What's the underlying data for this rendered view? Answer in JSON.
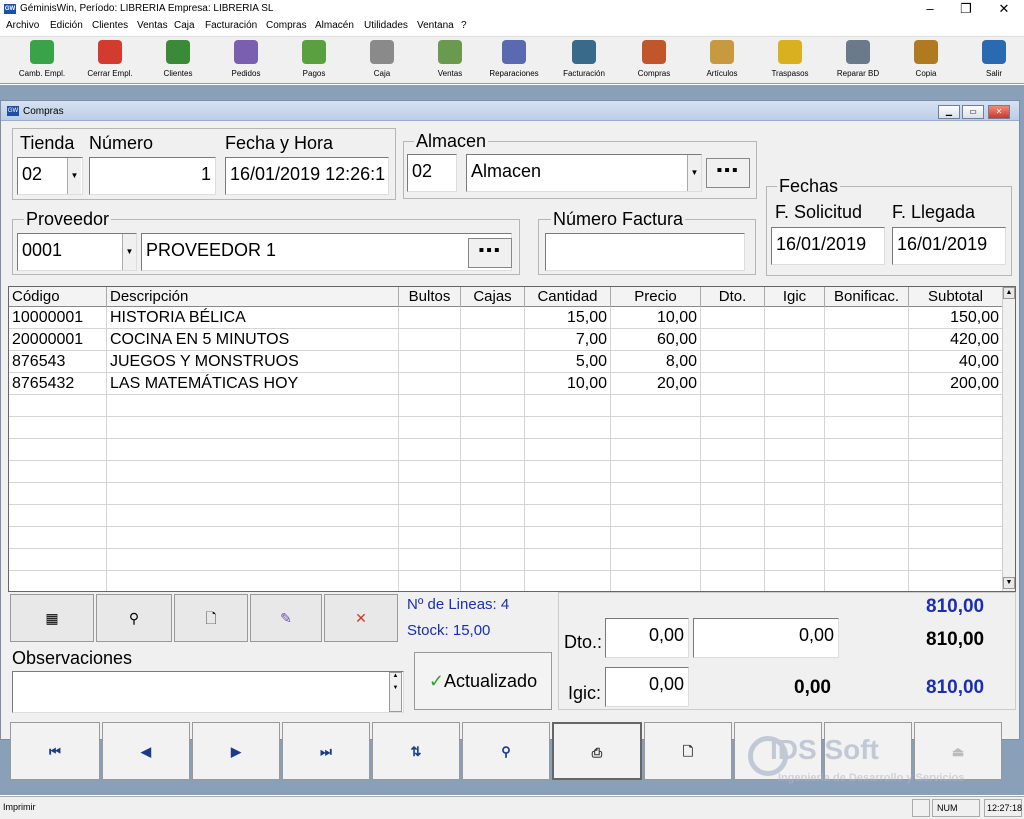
{
  "app": {
    "title": "GéminisWin, Período: LIBRERIA Empresa: LIBRERIA SL",
    "icon": "GW"
  },
  "menu": [
    "Archivo",
    "Edición",
    "Clientes",
    "Ventas",
    "Caja",
    "Facturación",
    "Compras",
    "Almacén",
    "Utilidades",
    "Ventana",
    "?"
  ],
  "toolbar": [
    {
      "label": "Camb. Empl.",
      "icon": "user-add-icon",
      "color": "#3aa34a"
    },
    {
      "label": "Cerrar Empl.",
      "icon": "user-close-icon",
      "color": "#d33b2f"
    },
    {
      "label": "Clientes",
      "icon": "clients-icon",
      "color": "#3a8a3a"
    },
    {
      "label": "Pedidos",
      "icon": "orders-icon",
      "color": "#7a5fb0"
    },
    {
      "label": "Pagos",
      "icon": "payments-icon",
      "color": "#5aa040"
    },
    {
      "label": "Caja",
      "icon": "cash-register-icon",
      "color": "#8a8a8a"
    },
    {
      "label": "Ventas",
      "icon": "sales-icon",
      "color": "#6a9a50"
    },
    {
      "label": "Reparaciones",
      "icon": "repair-icon",
      "color": "#5a6ab0"
    },
    {
      "label": "Facturación",
      "icon": "invoice-icon",
      "color": "#3a6a8a"
    },
    {
      "label": "Compras",
      "icon": "cart-icon",
      "color": "#c0562a"
    },
    {
      "label": "Artículos",
      "icon": "boxes-icon",
      "color": "#c89a40"
    },
    {
      "label": "Traspasos",
      "icon": "transfer-icon",
      "color": "#d8b020"
    },
    {
      "label": "Reparar BD",
      "icon": "database-icon",
      "color": "#6a7a8a"
    },
    {
      "label": "Copia",
      "icon": "copy-icon",
      "color": "#b07a20"
    },
    {
      "label": "Salir",
      "icon": "exit-icon",
      "color": "#2a6ab0"
    }
  ],
  "window": {
    "title": "Compras"
  },
  "form": {
    "tienda_label": "Tienda",
    "tienda_value": "02",
    "numero_label": "Número",
    "numero_value": "1",
    "fecha_label": "Fecha y Hora",
    "fecha_value": "16/01/2019 12:26:1",
    "almacen_label": "Almacen",
    "almacen_code": "02",
    "almacen_name": "Almacen",
    "proveedor_label": "Proveedor",
    "proveedor_code": "0001",
    "proveedor_name": "PROVEEDOR 1",
    "factura_label": "Número Factura",
    "factura_value": "",
    "fechas_label": "Fechas",
    "solicitud_label": "F. Solicitud",
    "solicitud_value": "16/01/2019",
    "llegada_label": "F. Llegada",
    "llegada_value": "16/01/2019"
  },
  "grid": {
    "headers": [
      "Código",
      "Descripción",
      "Bultos",
      "Cajas",
      "Cantidad",
      "Precio",
      "Dto.",
      "Igic",
      "Bonificac.",
      "Subtotal"
    ],
    "rows": [
      [
        "10000001",
        "HISTORIA BÉLICA",
        "",
        "",
        "15,00",
        "10,00",
        "",
        "",
        "",
        "150,00"
      ],
      [
        "20000001",
        "COCINA EN 5 MINUTOS",
        "",
        "",
        "7,00",
        "60,00",
        "",
        "",
        "",
        "420,00"
      ],
      [
        "876543",
        "JUEGOS Y MONSTRUOS",
        "",
        "",
        "5,00",
        "8,00",
        "",
        "",
        "",
        "40,00"
      ],
      [
        "8765432",
        "LAS MATEMÁTICAS HOY",
        "",
        "",
        "10,00",
        "20,00",
        "",
        "",
        "",
        "200,00"
      ]
    ]
  },
  "summary": {
    "lineas": "Nº de Lineas: 4",
    "stock": "Stock: 15,00",
    "total_top": "810,00",
    "dto_label": "Dto.:",
    "dto_pct": "0,00",
    "dto_amount": "0,00",
    "dto_total": "810,00",
    "igic_label": "Igic:",
    "igic_pct": "0,00",
    "igic_amount": "0,00",
    "igic_total": "810,00",
    "observaciones_label": "Observaciones",
    "observaciones_value": "",
    "actualizado": "Actualizado"
  },
  "watermark": {
    "title": "IDS Soft",
    "subtitle": "Ingeniería de Desarrollo y Servicios"
  },
  "status": {
    "left": "Imprimir",
    "num": "NUM",
    "time": "12:27:18"
  }
}
